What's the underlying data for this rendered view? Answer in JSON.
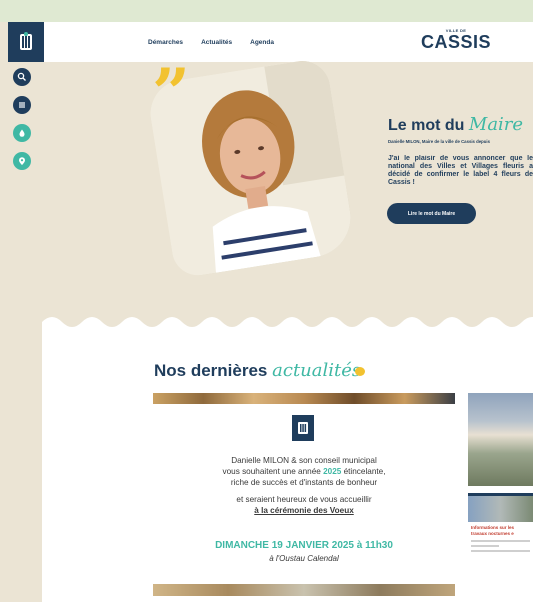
{
  "header": {
    "nav": [
      "Démarches",
      "Actualités",
      "Agenda"
    ],
    "brand_small": "VILLE DE",
    "brand_main": "CASSIS"
  },
  "sidebar": {
    "icons": [
      "search-icon",
      "menu-icon",
      "drop-icon",
      "location-icon"
    ]
  },
  "hero": {
    "title_plain": "Le mot du",
    "title_script": "Maire",
    "subtitle": "Danielle MILON, Maire de la ville de Cassis depuis",
    "text": "J'ai le plaisir de vous annoncer que le national des Villes et Villages fleuris a décidé de confirmer le label 4 fleurs de Cassis !",
    "button": "Lire le mot du Maire"
  },
  "news": {
    "title_plain": "Nos dernières",
    "title_script": "actualités",
    "card": {
      "line1": "Danielle MILON & son conseil municipal",
      "line2_a": "vous souhaitent une année ",
      "line2_year": "2025",
      "line2_b": " étincelante,",
      "line3": "riche de succès et d'instants de bonheur",
      "line4": "et seraient heureux de vous accueillir",
      "line5": "à la cérémonie des Voeux",
      "date": "DIMANCHE 19 JANVIER 2025 à 11h30",
      "place": "à l'Oustau Calendal"
    },
    "side_card_title": "Informations sur les travaux nocturnes e"
  },
  "colors": {
    "navy": "#1f3d5c",
    "teal": "#3fb8a4",
    "yellow": "#f2c230",
    "beige": "#ebe4d4"
  }
}
